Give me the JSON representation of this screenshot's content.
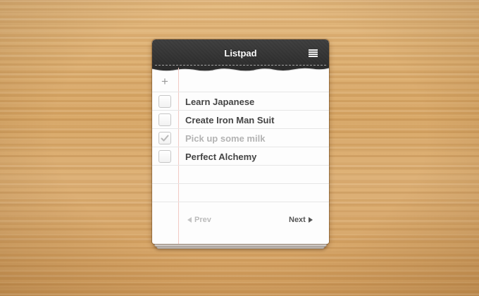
{
  "app": {
    "title": "Listpad",
    "menu_icon": "hamburger-menu-icon"
  },
  "composer": {
    "add_icon": "plus-icon",
    "add_label": "+",
    "placeholder": "",
    "value": ""
  },
  "items": [
    {
      "label": "Learn Japanese",
      "checked": false
    },
    {
      "label": "Create Iron Man Suit",
      "checked": false
    },
    {
      "label": "Pick up some milk",
      "checked": true
    },
    {
      "label": "Perfect Alchemy",
      "checked": false
    }
  ],
  "pager": {
    "prev_label": "Prev",
    "next_label": "Next",
    "prev_enabled": false,
    "next_enabled": true
  },
  "colors": {
    "header": "#2f2f2f",
    "text": "#444444",
    "completed_text": "#b3b3b3",
    "margin_line": "#f1c9c4",
    "background_wood": "#d9a868"
  }
}
